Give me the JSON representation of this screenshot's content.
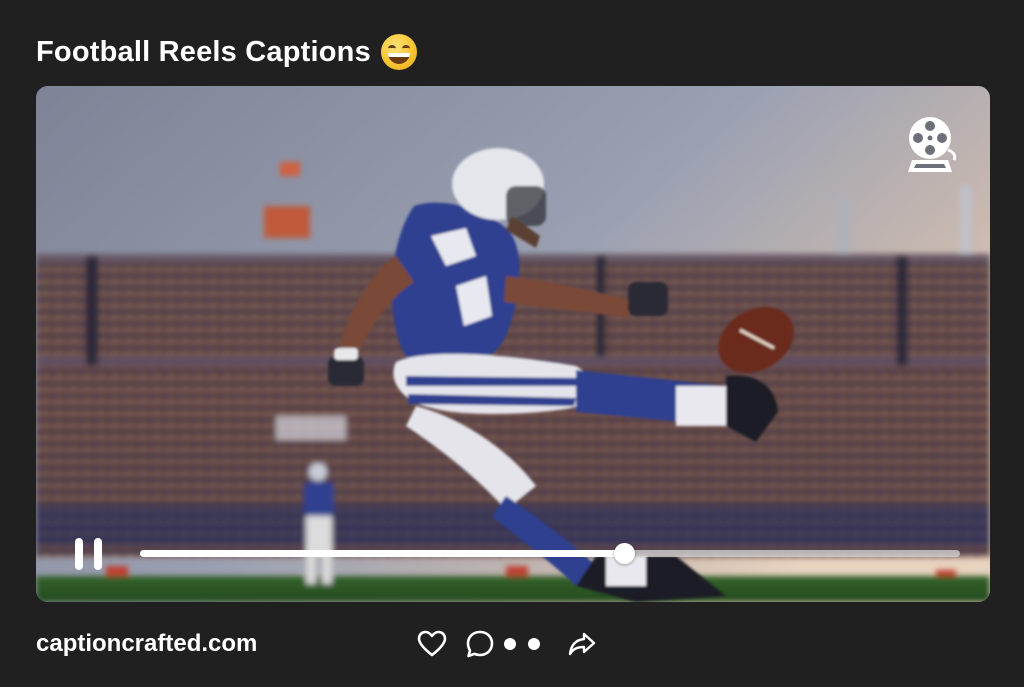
{
  "post": {
    "title": "Football Reels Captions",
    "title_emoji": "grinning-squinting-face-emoji",
    "site": "captioncrafted.com"
  },
  "video": {
    "player_icon": "film-reel-icon",
    "pause_icon": "pause-icon",
    "progress": 0.59,
    "colors": {
      "jersey": "#2f3f8f",
      "sky": "#8e95a8",
      "field": "#2a5a22"
    }
  },
  "actions": {
    "like_icon": "heart-icon",
    "comment_icon": "comment-bubble-icon",
    "more_icon": "more-dots-icon",
    "share_icon": "share-arrow-icon"
  }
}
